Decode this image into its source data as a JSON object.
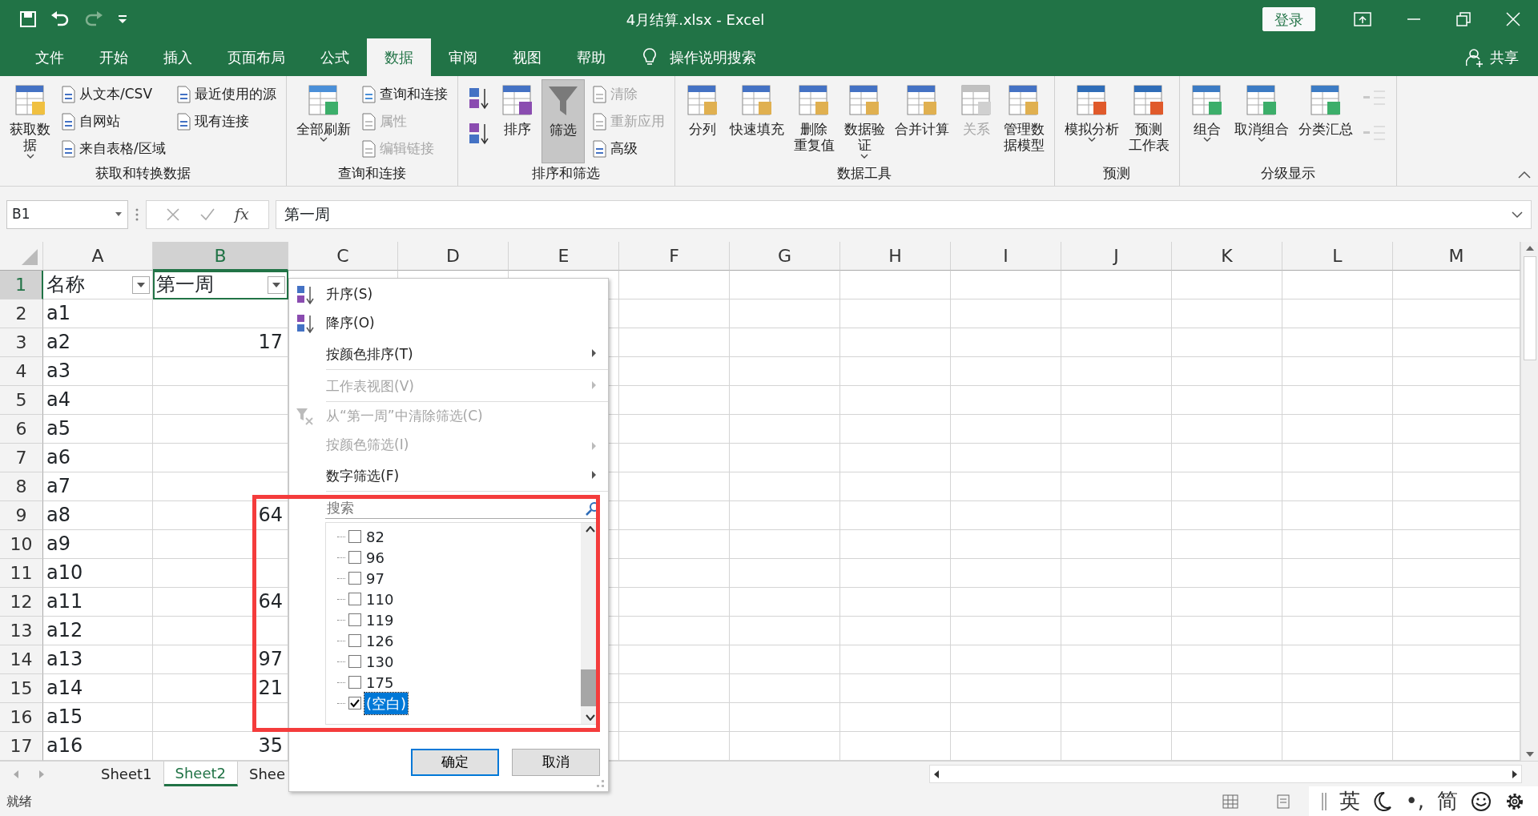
{
  "window": {
    "title": "4月结算.xlsx  -  Excel",
    "login_button": "登录"
  },
  "ribbon_tabs": [
    {
      "label": "文件",
      "selected": false
    },
    {
      "label": "开始",
      "selected": false
    },
    {
      "label": "插入",
      "selected": false
    },
    {
      "label": "页面布局",
      "selected": false
    },
    {
      "label": "公式",
      "selected": false
    },
    {
      "label": "数据",
      "selected": true
    },
    {
      "label": "审阅",
      "selected": false
    },
    {
      "label": "视图",
      "selected": false
    },
    {
      "label": "帮助",
      "selected": false
    }
  ],
  "tell_me": "操作说明搜索",
  "share": "共享",
  "ribbon": {
    "groups": [
      {
        "title": "获取和转换数据",
        "items": [
          {
            "kind": "large",
            "lines": [
              "获取数",
              "据"
            ],
            "dropdown": true,
            "disabled": false,
            "pressed": false
          },
          {
            "kind": "stack",
            "items": [
              {
                "kind": "small",
                "lines": [
                  "从文本/CSV"
                ],
                "disabled": false
              },
              {
                "kind": "small",
                "lines": [
                  "自网站"
                ],
                "disabled": false
              },
              {
                "kind": "small",
                "lines": [
                  "来自表格/区域"
                ],
                "disabled": false
              }
            ]
          },
          {
            "kind": "stack",
            "items": [
              {
                "kind": "small",
                "lines": [
                  "最近使用的源"
                ],
                "disabled": false
              },
              {
                "kind": "small",
                "lines": [
                  "现有连接"
                ],
                "disabled": false
              }
            ]
          }
        ]
      },
      {
        "title": "查询和连接",
        "items": [
          {
            "kind": "large",
            "lines": [
              "全部刷新"
            ],
            "dropdown": true,
            "disabled": false,
            "pressed": false
          },
          {
            "kind": "stack",
            "items": [
              {
                "kind": "small",
                "lines": [
                  "查询和连接"
                ],
                "disabled": false
              },
              {
                "kind": "small",
                "lines": [
                  "属性"
                ],
                "disabled": true
              },
              {
                "kind": "small",
                "lines": [
                  "编辑链接"
                ],
                "disabled": true
              }
            ]
          }
        ]
      },
      {
        "title": "排序和筛选",
        "items": [
          {
            "kind": "stack",
            "items": [
              {
                "kind": "icon",
                "disabled": false
              },
              {
                "kind": "icon",
                "disabled": false
              }
            ]
          },
          {
            "kind": "large",
            "lines": [
              "排序"
            ],
            "dropdown": false,
            "disabled": false,
            "pressed": false
          },
          {
            "kind": "large",
            "lines": [
              "筛选"
            ],
            "dropdown": false,
            "disabled": false,
            "pressed": true
          },
          {
            "kind": "stack",
            "items": [
              {
                "kind": "small",
                "lines": [
                  "清除"
                ],
                "disabled": true
              },
              {
                "kind": "small",
                "lines": [
                  "重新应用"
                ],
                "disabled": true
              },
              {
                "kind": "small",
                "lines": [
                  "高级"
                ],
                "disabled": false
              }
            ]
          }
        ]
      },
      {
        "title": "数据工具",
        "items": [
          {
            "kind": "large",
            "lines": [
              "分列"
            ],
            "dropdown": false,
            "disabled": false,
            "pressed": false
          },
          {
            "kind": "large",
            "lines": [
              "快速填充"
            ],
            "dropdown": false,
            "disabled": false,
            "pressed": false
          },
          {
            "kind": "large",
            "lines": [
              "删除",
              "重复值"
            ],
            "dropdown": false,
            "disabled": false,
            "pressed": false
          },
          {
            "kind": "large",
            "lines": [
              "数据验",
              "证"
            ],
            "dropdown": true,
            "disabled": false,
            "pressed": false
          },
          {
            "kind": "large",
            "lines": [
              "合并计算"
            ],
            "dropdown": false,
            "disabled": false,
            "pressed": false
          },
          {
            "kind": "large",
            "lines": [
              "关系"
            ],
            "dropdown": false,
            "disabled": true,
            "pressed": false
          },
          {
            "kind": "large",
            "lines": [
              "管理数",
              "据模型"
            ],
            "dropdown": false,
            "disabled": false,
            "pressed": false
          }
        ]
      },
      {
        "title": "预测",
        "items": [
          {
            "kind": "large",
            "lines": [
              "模拟分析"
            ],
            "dropdown": true,
            "disabled": false,
            "pressed": false
          },
          {
            "kind": "large",
            "lines": [
              "预测",
              "工作表"
            ],
            "dropdown": false,
            "disabled": false,
            "pressed": false
          }
        ]
      },
      {
        "title": "分级显示",
        "items": [
          {
            "kind": "large",
            "lines": [
              "组合"
            ],
            "dropdown": true,
            "disabled": false,
            "pressed": false
          },
          {
            "kind": "large",
            "lines": [
              "取消组合"
            ],
            "dropdown": true,
            "disabled": false,
            "pressed": false
          },
          {
            "kind": "large",
            "lines": [
              "分类汇总"
            ],
            "dropdown": false,
            "disabled": false,
            "pressed": false
          },
          {
            "kind": "stack",
            "items": [
              {
                "kind": "icon",
                "disabled": true
              },
              {
                "kind": "icon",
                "disabled": true
              }
            ]
          }
        ]
      }
    ]
  },
  "name_box": "B1",
  "formula_bar": {
    "fx": "fx",
    "value": "第一周"
  },
  "columns": [
    {
      "label": "A",
      "selected": false
    },
    {
      "label": "B",
      "selected": true
    },
    {
      "label": "C",
      "selected": false
    },
    {
      "label": "D",
      "selected": false
    },
    {
      "label": "E",
      "selected": false
    },
    {
      "label": "F",
      "selected": false
    },
    {
      "label": "G",
      "selected": false
    },
    {
      "label": "H",
      "selected": false
    },
    {
      "label": "I",
      "selected": false
    },
    {
      "label": "J",
      "selected": false
    },
    {
      "label": "K",
      "selected": false
    },
    {
      "label": "L",
      "selected": false
    },
    {
      "label": "M",
      "selected": false
    }
  ],
  "rows": [
    {
      "number": "1",
      "selected": true,
      "cells": [
        "名称",
        "第一周"
      ],
      "filter_buttons": true
    },
    {
      "number": "2",
      "selected": false,
      "cells": [
        "a1",
        ""
      ],
      "filter_buttons": false
    },
    {
      "number": "3",
      "selected": false,
      "cells": [
        "a2",
        "17"
      ],
      "filter_buttons": false
    },
    {
      "number": "4",
      "selected": false,
      "cells": [
        "a3",
        ""
      ],
      "filter_buttons": false
    },
    {
      "number": "5",
      "selected": false,
      "cells": [
        "a4",
        ""
      ],
      "filter_buttons": false
    },
    {
      "number": "6",
      "selected": false,
      "cells": [
        "a5",
        ""
      ],
      "filter_buttons": false
    },
    {
      "number": "7",
      "selected": false,
      "cells": [
        "a6",
        ""
      ],
      "filter_buttons": false
    },
    {
      "number": "8",
      "selected": false,
      "cells": [
        "a7",
        ""
      ],
      "filter_buttons": false
    },
    {
      "number": "9",
      "selected": false,
      "cells": [
        "a8",
        "64"
      ],
      "filter_buttons": false
    },
    {
      "number": "10",
      "selected": false,
      "cells": [
        "a9",
        ""
      ],
      "filter_buttons": false
    },
    {
      "number": "11",
      "selected": false,
      "cells": [
        "a10",
        ""
      ],
      "filter_buttons": false
    },
    {
      "number": "12",
      "selected": false,
      "cells": [
        "a11",
        "64"
      ],
      "filter_buttons": false
    },
    {
      "number": "13",
      "selected": false,
      "cells": [
        "a12",
        ""
      ],
      "filter_buttons": false
    },
    {
      "number": "14",
      "selected": false,
      "cells": [
        "a13",
        "97"
      ],
      "filter_buttons": false
    },
    {
      "number": "15",
      "selected": false,
      "cells": [
        "a14",
        "21"
      ],
      "filter_buttons": false
    },
    {
      "number": "16",
      "selected": false,
      "cells": [
        "a15",
        ""
      ],
      "filter_buttons": false
    },
    {
      "number": "17",
      "selected": false,
      "cells": [
        "a16",
        "35"
      ],
      "filter_buttons": false
    }
  ],
  "sheet_tabs": [
    {
      "label": "Sheet1",
      "selected": false
    },
    {
      "label": "Sheet2",
      "selected": true
    },
    {
      "label": "Shee",
      "selected": false
    }
  ],
  "status_bar": {
    "text": "就绪"
  },
  "filter_menu": {
    "items": [
      {
        "kind": "sort-asc",
        "label": "升序(S)",
        "disabled": false,
        "separator_after": false
      },
      {
        "kind": "sort-desc",
        "label": "降序(O)",
        "disabled": false,
        "separator_after": false
      },
      {
        "kind": "submenu",
        "label": "按颜色排序(T)",
        "disabled": false,
        "separator_after": true
      },
      {
        "kind": "submenu",
        "label": "工作表视图(V)",
        "disabled": true,
        "separator_after": true
      },
      {
        "kind": "clear-filter",
        "label": "从“第一周”中清除筛选(C)",
        "disabled": true,
        "separator_after": false
      },
      {
        "kind": "submenu",
        "label": "按颜色筛选(I)",
        "disabled": true,
        "separator_after": false
      },
      {
        "kind": "submenu",
        "label": "数字筛选(F)",
        "disabled": false,
        "separator_after": true
      }
    ],
    "search": {
      "placeholder": "搜索"
    },
    "values": [
      {
        "label": "82",
        "checked": false,
        "selected": false
      },
      {
        "label": "96",
        "checked": false,
        "selected": false
      },
      {
        "label": "97",
        "checked": false,
        "selected": false
      },
      {
        "label": "110",
        "checked": false,
        "selected": false
      },
      {
        "label": "119",
        "checked": false,
        "selected": false
      },
      {
        "label": "126",
        "checked": false,
        "selected": false
      },
      {
        "label": "130",
        "checked": false,
        "selected": false
      },
      {
        "label": "175",
        "checked": false,
        "selected": false
      },
      {
        "label": "(空白)",
        "checked": true,
        "selected": true
      }
    ],
    "buttons": [
      {
        "label": "确定",
        "default": true
      },
      {
        "label": "取消",
        "default": false
      }
    ]
  },
  "ime_toolbar": {
    "language": "英",
    "punctuation": "•,",
    "script": "简"
  }
}
